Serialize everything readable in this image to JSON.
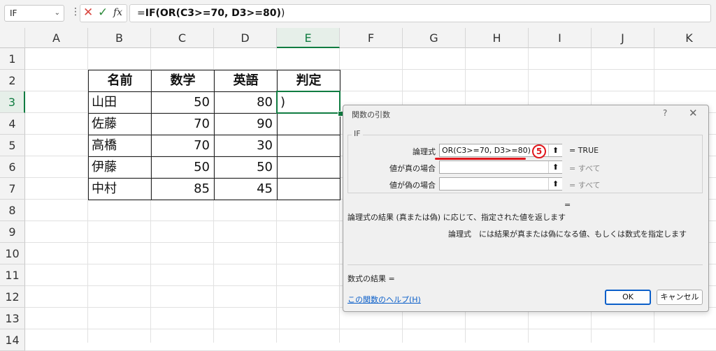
{
  "formula_bar": {
    "name_box": "IF",
    "name_box_arrow": "⌄",
    "dots": "⋮",
    "cancel_glyph": "✕",
    "enter_glyph": "✓",
    "fx_glyph": "fx",
    "formula_prefix": "=",
    "formula_bold": "IF(OR(C3>=70, D3>=80)",
    "formula_suffix": ")"
  },
  "columns": [
    "A",
    "B",
    "C",
    "D",
    "E",
    "F",
    "G",
    "H",
    "I",
    "J",
    "K"
  ],
  "rows": [
    "1",
    "2",
    "3",
    "4",
    "5",
    "6",
    "7",
    "8",
    "9",
    "10",
    "11",
    "12",
    "13",
    "14"
  ],
  "table": {
    "headers": [
      "名前",
      "数学",
      "英語",
      "判定"
    ],
    "rows": [
      [
        "山田",
        "50",
        "80",
        ")"
      ],
      [
        "佐藤",
        "70",
        "90",
        ""
      ],
      [
        "高橋",
        "70",
        "30",
        ""
      ],
      [
        "伊藤",
        "50",
        "50",
        ""
      ],
      [
        "中村",
        "85",
        "45",
        ""
      ]
    ]
  },
  "dialog": {
    "title": "関数の引数",
    "help_glyph": "?",
    "close_glyph": "✕",
    "function_name": "IF",
    "args": [
      {
        "label": "論理式",
        "value": "OR(C3>=70, D3>=80)",
        "result": "=  TRUE"
      },
      {
        "label": "値が真の場合",
        "value": "",
        "result": "=  すべて"
      },
      {
        "label": "値が偽の場合",
        "value": "",
        "result": "=  すべて"
      }
    ],
    "arg_button_glyph": "⬆",
    "step_marker": "5",
    "overall_equals": "=",
    "description": "論理式の結果 (真または偽) に応じて、指定された値を返します",
    "arg_description": "論理式　には結果が真または偽になる値、もしくは数式を指定します",
    "formula_result": "数式の結果 =",
    "help_link": "この関数のヘルプ(H)",
    "ok_label": "OK",
    "cancel_label": "キャンセル"
  },
  "colors": {
    "accent_green": "#107c41",
    "marker_red": "#e0161c",
    "link_blue": "#0b5fc9"
  }
}
